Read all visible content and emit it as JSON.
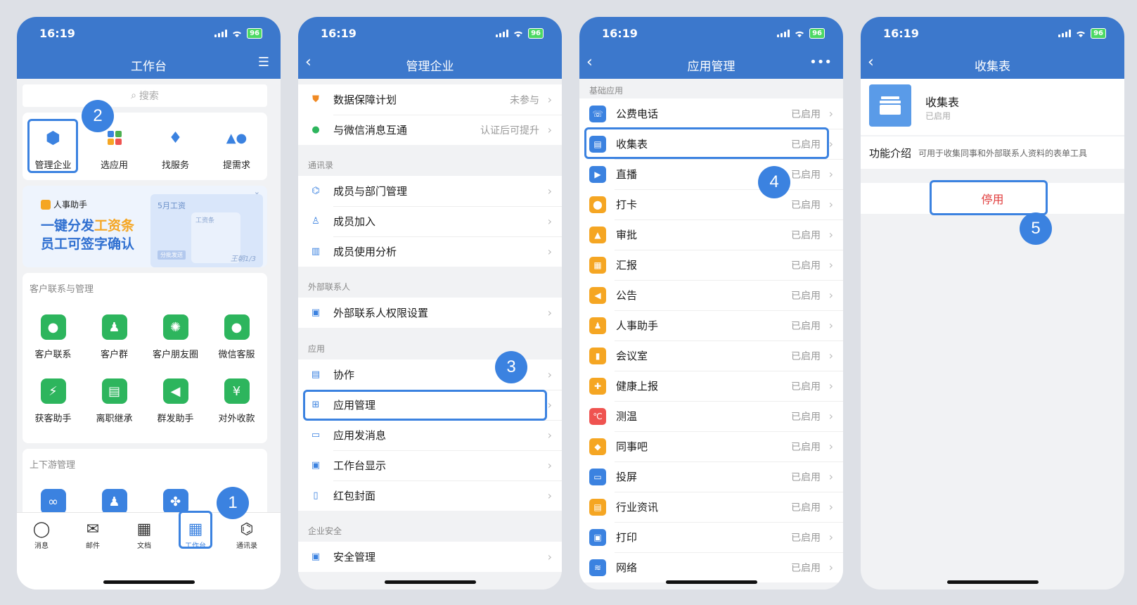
{
  "status": {
    "time": "16:19",
    "battery": "96"
  },
  "phone1": {
    "title": "工作台",
    "search_placeholder": "搜索",
    "quick": [
      {
        "label": "管理企业",
        "icon": "hexagon-icon"
      },
      {
        "label": "选应用",
        "icon": "apps-icon"
      },
      {
        "label": "找服务",
        "icon": "tie-icon"
      },
      {
        "label": "提需求",
        "icon": "shapes-icon"
      }
    ],
    "banner": {
      "tag": "人事助手",
      "line1a": "一键分发",
      "line1b": "工资条",
      "line2": "员工可签字确认",
      "card_title": "5月工资",
      "card_sub": "工资条",
      "card_btn": "分批发送",
      "sign": "王朝1/3"
    },
    "section1": "客户联系与管理",
    "apps1": [
      {
        "label": "客户联系",
        "icon": "chat-icon"
      },
      {
        "label": "客户群",
        "icon": "group-icon"
      },
      {
        "label": "客户朋友圈",
        "icon": "moments-icon"
      },
      {
        "label": "微信客服",
        "icon": "service-icon"
      },
      {
        "label": "获客助手",
        "icon": "bolt-icon"
      },
      {
        "label": "离职继承",
        "icon": "transfer-icon"
      },
      {
        "label": "群发助手",
        "icon": "megaphone-icon"
      },
      {
        "label": "对外收款",
        "icon": "yuan-icon"
      }
    ],
    "section2": "上下游管理",
    "tabs": [
      "消息",
      "邮件",
      "文档",
      "工作台",
      "通讯录"
    ]
  },
  "phone2": {
    "title": "管理企业",
    "top": [
      {
        "label": "数据保障计划",
        "value": "未参与"
      },
      {
        "label": "与微信消息互通",
        "value": "认证后可提升"
      }
    ],
    "sec_contacts": "通讯录",
    "contacts": [
      "成员与部门管理",
      "成员加入",
      "成员使用分析"
    ],
    "sec_external": "外部联系人",
    "external": [
      "外部联系人权限设置"
    ],
    "sec_apps": "应用",
    "apps": [
      "协作",
      "应用管理",
      "应用发消息",
      "工作台显示",
      "红包封面"
    ],
    "sec_security": "企业安全",
    "security": [
      "安全管理"
    ]
  },
  "phone3": {
    "title": "应用管理",
    "section": "基础应用",
    "enabled": "已启用",
    "apps": [
      {
        "label": "公费电话",
        "color": "#3b82e0"
      },
      {
        "label": "收集表",
        "color": "#3b82e0"
      },
      {
        "label": "直播",
        "color": "#3b82e0"
      },
      {
        "label": "打卡",
        "color": "#f5a623"
      },
      {
        "label": "审批",
        "color": "#f5a623"
      },
      {
        "label": "汇报",
        "color": "#f5a623"
      },
      {
        "label": "公告",
        "color": "#f5a623"
      },
      {
        "label": "人事助手",
        "color": "#f5a623"
      },
      {
        "label": "会议室",
        "color": "#f5a623"
      },
      {
        "label": "健康上报",
        "color": "#f5a623"
      },
      {
        "label": "测温",
        "color": "#ef5350"
      },
      {
        "label": "同事吧",
        "color": "#f5a623"
      },
      {
        "label": "投屏",
        "color": "#3b82e0"
      },
      {
        "label": "行业资讯",
        "color": "#f5a623"
      },
      {
        "label": "打印",
        "color": "#3b82e0"
      },
      {
        "label": "网络",
        "color": "#3b82e0"
      }
    ]
  },
  "phone4": {
    "title": "收集表",
    "app_name": "收集表",
    "app_status": "已启用",
    "intro_label": "功能介绍",
    "intro_text": "可用于收集同事和外部联系人资料的表单工具",
    "disable_btn": "停用"
  },
  "steps": [
    "1",
    "2",
    "3",
    "4",
    "5"
  ]
}
